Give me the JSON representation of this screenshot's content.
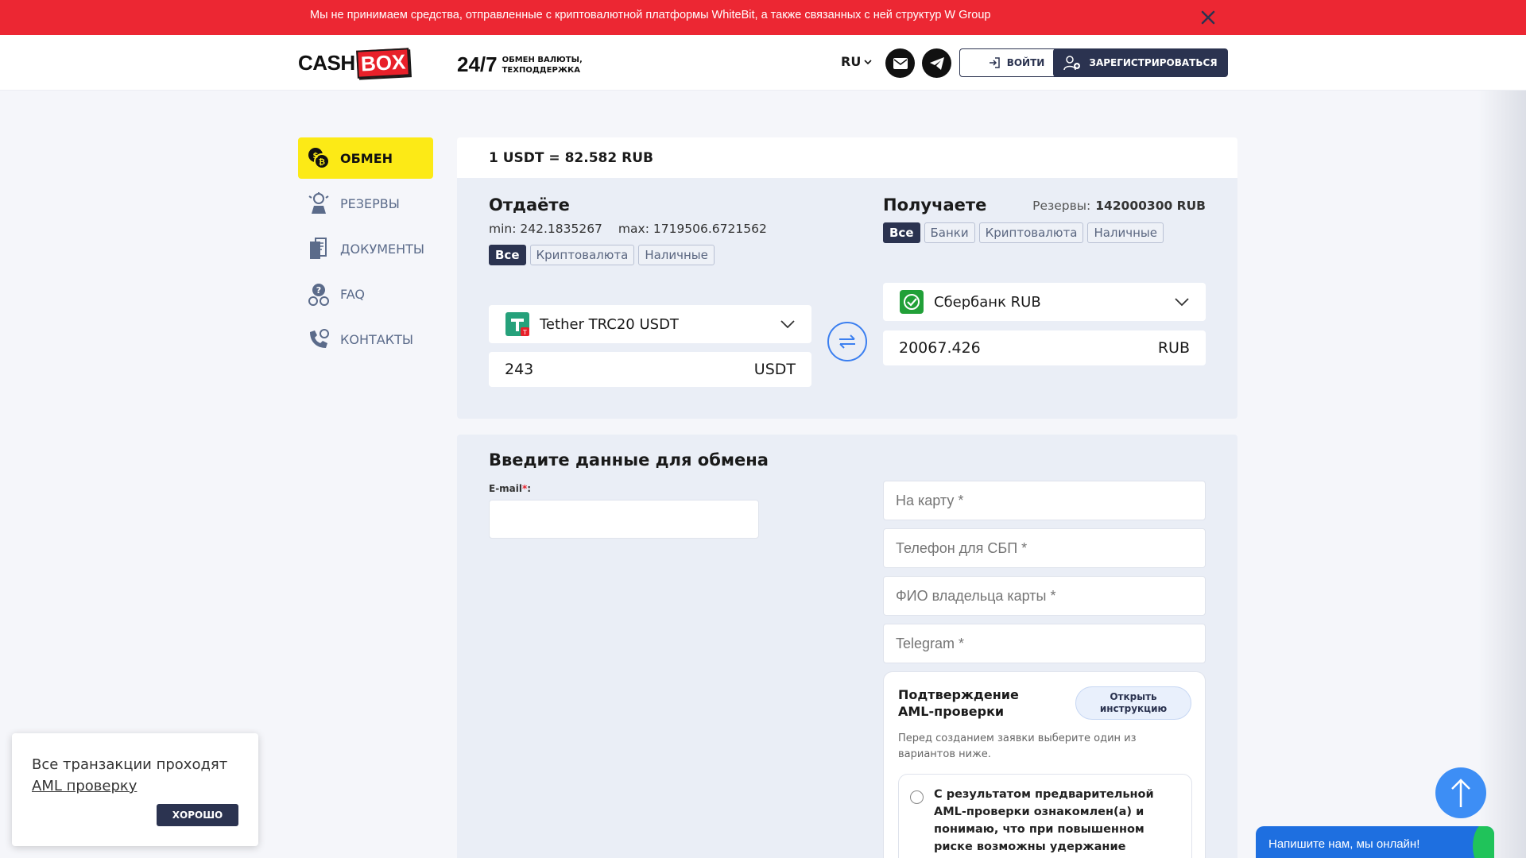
{
  "banner": {
    "text": "Мы не принимаем средства, отправленные с криптовалютной платформы WhiteBit, а также связанных с ней структур W Group",
    "close_icon": "close-icon",
    "color": "#ec2733"
  },
  "header": {
    "logo_cash": "CASH",
    "logo_box": "BOX",
    "slogan_big": "24/7",
    "slogan_line1": "ОБМЕН ВАЛЮТЫ,",
    "slogan_line2": "ТЕХПОДДЕРЖКА",
    "lang": "RU",
    "login": "ВОЙТИ",
    "register": "ЗАРЕГИСТРИРОВАТЬСЯ"
  },
  "sidebar": {
    "items": [
      {
        "label": "ОБМЕН",
        "icon": "coins-exchange-icon",
        "active": true
      },
      {
        "label": "РЕЗЕРВЫ",
        "icon": "reserves-icon",
        "active": false
      },
      {
        "label": "ДОКУМЕНТЫ",
        "icon": "documents-icon",
        "active": false
      },
      {
        "label": "FAQ",
        "icon": "faq-icon",
        "active": false
      },
      {
        "label": "КОНТАКТЫ",
        "icon": "contacts-icon",
        "active": false
      }
    ]
  },
  "exchange": {
    "rate": "1 USDT = 82.582 RUB",
    "give": {
      "title": "Отдаёте",
      "min": "min: 242.1835267",
      "max": "max: 1719506.6721562",
      "tags": [
        "Все",
        "Криптовалюта",
        "Наличные"
      ],
      "currency": "Tether TRC20 USDT",
      "amount": "243",
      "unit": "USDT"
    },
    "get": {
      "title": "Получаете",
      "reserve_label": "Резервы:",
      "reserve_value": "142000300 RUB",
      "tags": [
        "Все",
        "Банки",
        "Криптовалюта",
        "Наличные"
      ],
      "currency": "Сбербанк RUB",
      "amount": "20067.426",
      "unit": "RUB"
    }
  },
  "form": {
    "title": "Введите данные для обмена",
    "email_label": "E-mail",
    "email_req": "*",
    "email_colon": ":",
    "card_placeholder": "На карту *",
    "phone_placeholder": "Телефон для СБП *",
    "name_placeholder": "ФИО владельца карты *",
    "telegram_placeholder": "Telegram *",
    "aml": {
      "title": "Подтверждение AML-проверки",
      "button": "Открыть инструкцию",
      "desc": "Перед созданием заявки выберите один из вариантов ниже.",
      "option": "С результатом предварительной AML-проверки ознакомлен(а) и понимаю, что при повышенном риске возможны удержание операции, заморозка средств"
    }
  },
  "cookie": {
    "text": "Все транзакции проходят",
    "link": "AML проверку",
    "ok": "ХОРОШО"
  },
  "chat": {
    "text": "Напишите нам, мы онлайн!"
  }
}
